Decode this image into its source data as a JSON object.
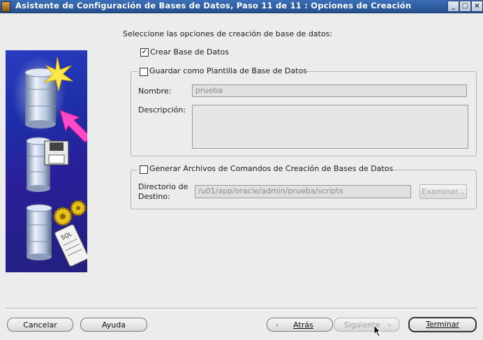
{
  "window": {
    "title": "Asistente de Configuración de Bases de Datos, Paso 11 de 11 : Opciones de Creación",
    "controls": {
      "minimize": "_",
      "maximize": "□",
      "close": "×"
    }
  },
  "instruction": "Seleccione las opciones de creación de base de datos:",
  "options": {
    "create_db": {
      "label": "Crear Base de Datos",
      "checked": true
    },
    "save_template": {
      "label": "Guardar como Plantilla de Base de Datos",
      "checked": false
    },
    "generate_scripts": {
      "label": "Generar Archivos de Comandos de Creación de Bases de Datos",
      "checked": false
    }
  },
  "template": {
    "name_label": "Nombre:",
    "name_value": "prueba",
    "description_label": "Descripción:",
    "description_value": ""
  },
  "scripts": {
    "dir_label_line1": "Directorio de",
    "dir_label_line2": "Destino:",
    "dir_value": "/u01/app/oracle/admin/prueba/scripts",
    "browse_label": "Examinar..."
  },
  "illustration": {
    "badge_text": "SQL"
  },
  "footer": {
    "cancel": "Cancelar",
    "help": "Ayuda",
    "back": "Atrás",
    "next": "Siguiente",
    "finish": "Terminar",
    "back_icon": "chevron-left-icon",
    "next_icon": "chevron-right-icon"
  }
}
